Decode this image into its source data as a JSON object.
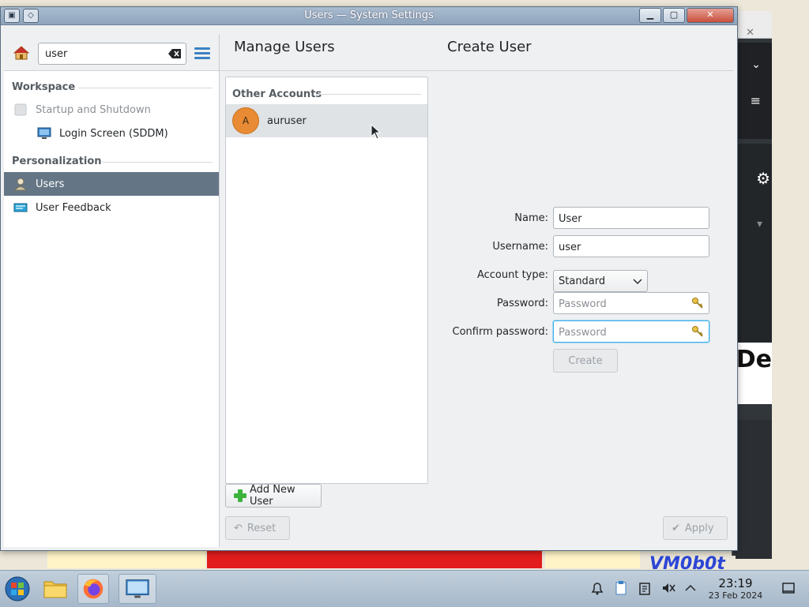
{
  "window": {
    "title": "Users — System Settings"
  },
  "sidebar": {
    "search_value": "user",
    "categories": [
      {
        "label": "Workspace"
      },
      {
        "label": "Personalization"
      }
    ],
    "items": [
      {
        "label": "Startup and Shutdown",
        "state": "dimmed",
        "icon": "power-icon"
      },
      {
        "label": "Login Screen (SDDM)",
        "state": "normal",
        "icon": "monitor-icon"
      },
      {
        "label": "Users",
        "state": "selected",
        "icon": "users-icon"
      },
      {
        "label": "User Feedback",
        "state": "normal",
        "icon": "feedback-icon"
      }
    ]
  },
  "manage_users": {
    "header": "Manage Users",
    "section_label": "Other Accounts",
    "accounts": [
      {
        "initial": "A",
        "name": "auruser"
      }
    ],
    "add_button": "Add New User",
    "reset_button": "Reset"
  },
  "create_user": {
    "header": "Create User",
    "name_label": "Name:",
    "name_value": "User",
    "username_label": "Username:",
    "username_value": "user",
    "account_type_label": "Account type:",
    "account_type_value": "Standard",
    "password_label": "Password:",
    "password_placeholder": "Password",
    "confirm_label": "Confirm password:",
    "confirm_placeholder": "Password",
    "create_button": "Create",
    "apply_button": "Apply"
  },
  "taskbar": {
    "time": "23:19",
    "date": "23 Feb 2024"
  },
  "colors": {
    "selection": "#647585",
    "accent": "#3daee9",
    "avatar": "#e98b34"
  }
}
